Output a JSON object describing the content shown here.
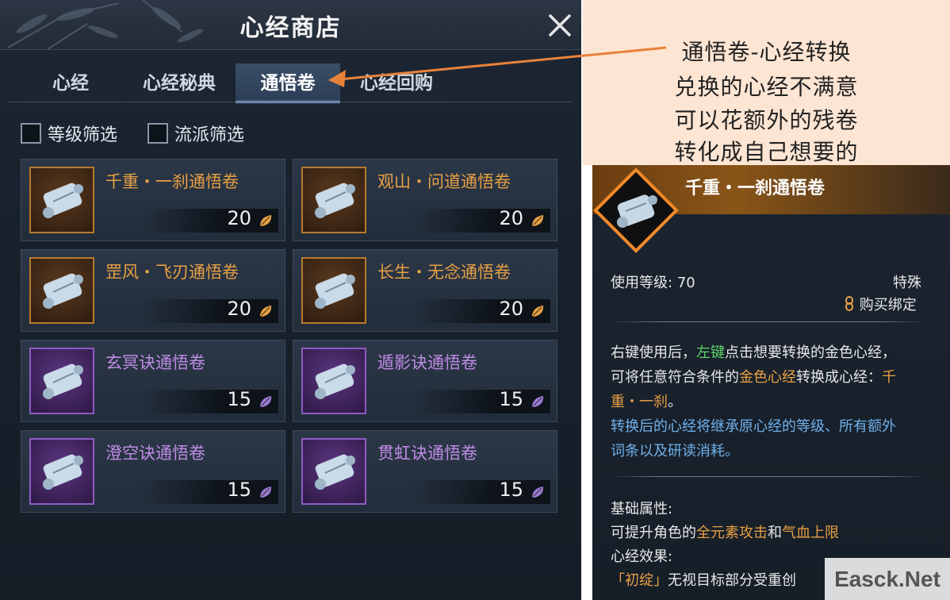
{
  "shop": {
    "title": "心经商店",
    "tabs": [
      {
        "label": "心经"
      },
      {
        "label": "心经秘典"
      },
      {
        "label": "通悟卷",
        "active": true
      },
      {
        "label": "心经回购"
      }
    ],
    "filters": [
      {
        "label": "等级筛选",
        "checked": false
      },
      {
        "label": "流派筛选",
        "checked": false
      }
    ],
    "items": [
      {
        "name": "千重・一刹通悟卷",
        "price": "20",
        "rarity": "gold",
        "currency_icon": "gold-leaf-icon"
      },
      {
        "name": "观山・问道通悟卷",
        "price": "20",
        "rarity": "gold",
        "currency_icon": "gold-leaf-icon"
      },
      {
        "name": "罡风・飞刃通悟卷",
        "price": "20",
        "rarity": "gold",
        "currency_icon": "gold-leaf-icon"
      },
      {
        "name": "长生・无念通悟卷",
        "price": "20",
        "rarity": "gold",
        "currency_icon": "gold-leaf-icon"
      },
      {
        "name": "玄冥诀通悟卷",
        "price": "15",
        "rarity": "purple",
        "currency_icon": "purple-leaf-icon"
      },
      {
        "name": "遁影诀通悟卷",
        "price": "15",
        "rarity": "purple",
        "currency_icon": "purple-leaf-icon"
      },
      {
        "name": "澄空诀通悟卷",
        "price": "15",
        "rarity": "purple",
        "currency_icon": "purple-leaf-icon"
      },
      {
        "name": "贯虹诀通悟卷",
        "price": "15",
        "rarity": "purple",
        "currency_icon": "purple-leaf-icon"
      }
    ]
  },
  "callout": {
    "lines": [
      "通悟卷-心经转换",
      "兑换的心经不满意",
      "可以花额外的残卷",
      "转化成自己想要的"
    ],
    "arrow_color": "#e8823a"
  },
  "tooltip": {
    "title": "千重・一刹通悟卷",
    "level_label": "使用等级:",
    "level_value": "70",
    "type": "特殊",
    "bind": "购买绑定",
    "desc": {
      "p1": "右键使用后，",
      "p2": "左键",
      "p3": "点击想要转换的金色心经，",
      "p4": "可将任意符合条件的",
      "p5": "金色心经",
      "p6": "转换成心经：",
      "p7": "千",
      "p8": "重・一刹",
      "p9": "。",
      "blue1": "转换后的心经将继承原心经的等级、所有额外",
      "blue2": "词条以及研读消耗。"
    },
    "base_label": "基础属性:",
    "base": {
      "a": "可提升角色的",
      "b": "全元素攻击",
      "c": "和",
      "d": "气血上限"
    },
    "effect_label": "心经效果:",
    "effect": {
      "a": "「初绽」",
      "b": "无视目标部分受重创"
    }
  },
  "watermark": "Easck.Net",
  "colors": {
    "gold": "#e9a044",
    "purple": "#c08ce6",
    "green": "#5fd36b",
    "blue": "#6fb0ea"
  }
}
